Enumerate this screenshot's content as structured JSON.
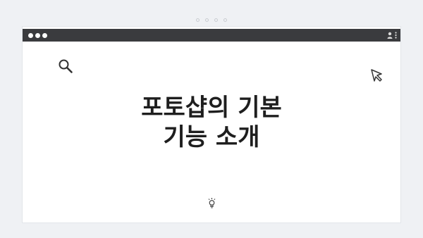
{
  "page": {
    "heading_line1": "포토샵의 기본",
    "heading_line2": "기능 소개"
  },
  "icons": {
    "window_controls": [
      "circle",
      "circle",
      "circle"
    ],
    "toolbar_right": [
      "user-icon",
      "more-vertical-icon"
    ],
    "content": [
      "search-icon",
      "cursor-pointer-icon",
      "lightbulb-icon"
    ]
  },
  "carousel": {
    "dot_count": 4
  },
  "colors": {
    "background": "#eff1f4",
    "title_bar": "#3a3b3e",
    "window": "#ffffff",
    "heading_text": "#1e1e1e",
    "icon_stroke": "#333333"
  }
}
